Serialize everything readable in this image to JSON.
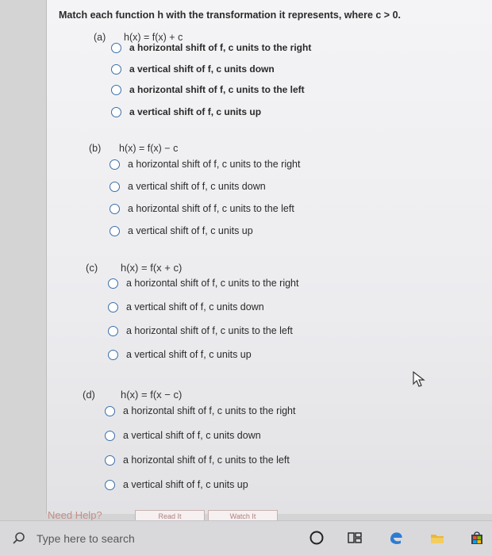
{
  "question": {
    "prompt": "Match each function h with the transformation it represents, where c > 0."
  },
  "parts": [
    {
      "letter": "(a)",
      "equation": "h(x) = f(x) + c",
      "options": [
        "a horizontal shift of f, c units to the right",
        "a vertical shift of f, c units down",
        "a horizontal shift of f, c units to the left",
        "a vertical shift of f, c units up"
      ]
    },
    {
      "letter": "(b)",
      "equation": "h(x) = f(x) − c",
      "options": [
        "a horizontal shift of f, c units to the right",
        "a vertical shift of f, c units down",
        "a horizontal shift of f, c units to the left",
        "a vertical shift of f, c units up"
      ]
    },
    {
      "letter": "(c)",
      "equation": "h(x) = f(x + c)",
      "options": [
        "a horizontal shift of f, c units to the right",
        "a vertical shift of f, c units down",
        "a horizontal shift of f, c units to the left",
        "a vertical shift of f, c units up"
      ]
    },
    {
      "letter": "(d)",
      "equation": "h(x) = f(x − c)",
      "options": [
        "a horizontal shift of f, c units to the right",
        "a vertical shift of f, c units down",
        "a horizontal shift of f, c units to the left",
        "a vertical shift of f, c units up"
      ]
    }
  ],
  "footer": {
    "need_help": "Need Help?",
    "read_it": "Read It",
    "watch_it": "Watch It"
  },
  "taskbar": {
    "search_placeholder": "Type here to search",
    "icons": [
      "search-icon",
      "cortana-icon",
      "task-view-icon",
      "edge-icon",
      "file-explorer-icon",
      "store-icon"
    ]
  },
  "colors": {
    "radio_border": "#3c6fa8",
    "help_text": "#c58f88",
    "taskbar_bg": "#d9d9dc"
  }
}
